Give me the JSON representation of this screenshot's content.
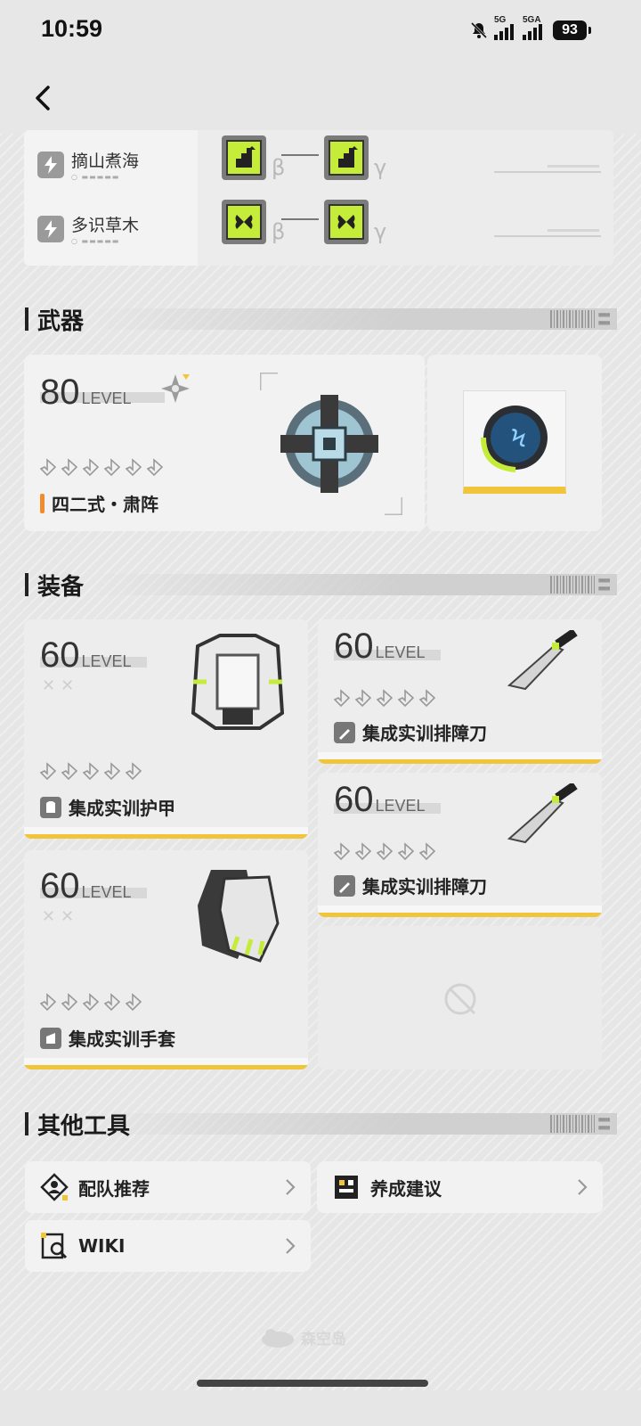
{
  "status_bar": {
    "time": "10:59",
    "signal1_label": "5G",
    "signal2_label": "5GA",
    "battery": "93"
  },
  "skills": [
    {
      "name": "摘山煮海",
      "rune_left_greek": "β",
      "rune_right_greek": "γ",
      "icon": "bolt-icon",
      "rune_icon": "arrow-up-rune-icon"
    },
    {
      "name": "多识草木",
      "rune_left_greek": "β",
      "rune_right_greek": "γ",
      "icon": "bolt-icon",
      "rune_icon": "leaf-rune-icon"
    }
  ],
  "sections": {
    "weapon": "武器",
    "equipment": "装备",
    "tools": "其他工具"
  },
  "weapon": {
    "level": "80",
    "level_word": "LEVEL",
    "name": "四二式・肃阵",
    "stars": 6
  },
  "equipment": [
    {
      "level": "60",
      "level_word": "LEVEL",
      "name": "集成实训护甲",
      "stars": 5,
      "icon": "armor-icon"
    },
    {
      "level": "60",
      "level_word": "LEVEL",
      "name": "集成实训排障刀",
      "stars": 5,
      "icon": "blade-icon"
    },
    {
      "level": "60",
      "level_word": "LEVEL",
      "name": "集成实训排障刀",
      "stars": 5,
      "icon": "blade-icon"
    },
    {
      "level": "60",
      "level_word": "LEVEL",
      "name": "集成实训手套",
      "stars": 5,
      "icon": "glove-icon"
    }
  ],
  "tools": [
    {
      "label": "配队推荐",
      "icon": "team-icon"
    },
    {
      "label": "养成建议",
      "icon": "growth-icon"
    },
    {
      "label": "WIKI",
      "icon": "wiki-icon"
    }
  ],
  "watermark": "森空岛",
  "colors": {
    "accent_yellow": "#f0c53a",
    "accent_lime": "#c6ec3a",
    "orange": "#f28a2e"
  }
}
